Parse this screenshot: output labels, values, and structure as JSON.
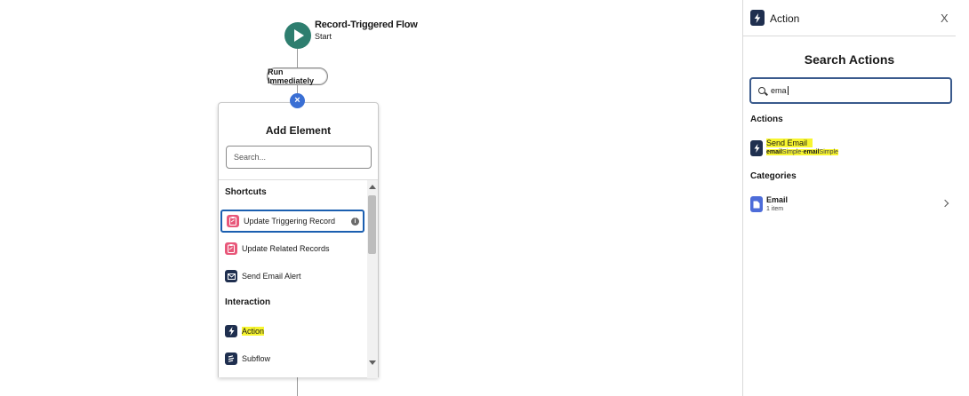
{
  "flow": {
    "start_title": "Record-Triggered Flow",
    "start_subtitle": "Start",
    "run_label": "Run Immediately",
    "close_glyph": "×"
  },
  "add_element": {
    "title": "Add Element",
    "search_placeholder": "Search...",
    "sections": {
      "shortcuts": "Shortcuts",
      "interaction": "Interaction"
    },
    "items": [
      {
        "label": "Update Triggering Record",
        "icon": "update-record-icon",
        "selected": true
      },
      {
        "label": "Update Related Records",
        "icon": "update-records-icon",
        "selected": false
      },
      {
        "label": "Send Email Alert",
        "icon": "email-alert-icon",
        "selected": false
      },
      {
        "label": "Action",
        "icon": "action-bolt-icon",
        "selected": false,
        "highlighted": true
      },
      {
        "label": "Subflow",
        "icon": "subflow-icon",
        "selected": false
      }
    ],
    "info_glyph": "i"
  },
  "panel": {
    "header_title": "Action",
    "close_glyph": "X",
    "search_title": "Search Actions",
    "search_value": "ema",
    "actions_heading": "Actions",
    "categories_heading": "Categories",
    "action_result": {
      "title": "Send Email",
      "sub_bold_1": "email",
      "sub_plain_1": "Simple-",
      "sub_bold_2": "email",
      "sub_plain_2": "Simple"
    },
    "category_result": {
      "title": "Email",
      "sub": "1 item"
    }
  },
  "colors": {
    "start_node": "#2e7e6f",
    "action_icon": "#1f2f4f",
    "record_icon": "#e8587a",
    "category_icon": "#4d6cd9",
    "highlight": "#f7f52f",
    "selection_border": "#1b5fb0"
  }
}
